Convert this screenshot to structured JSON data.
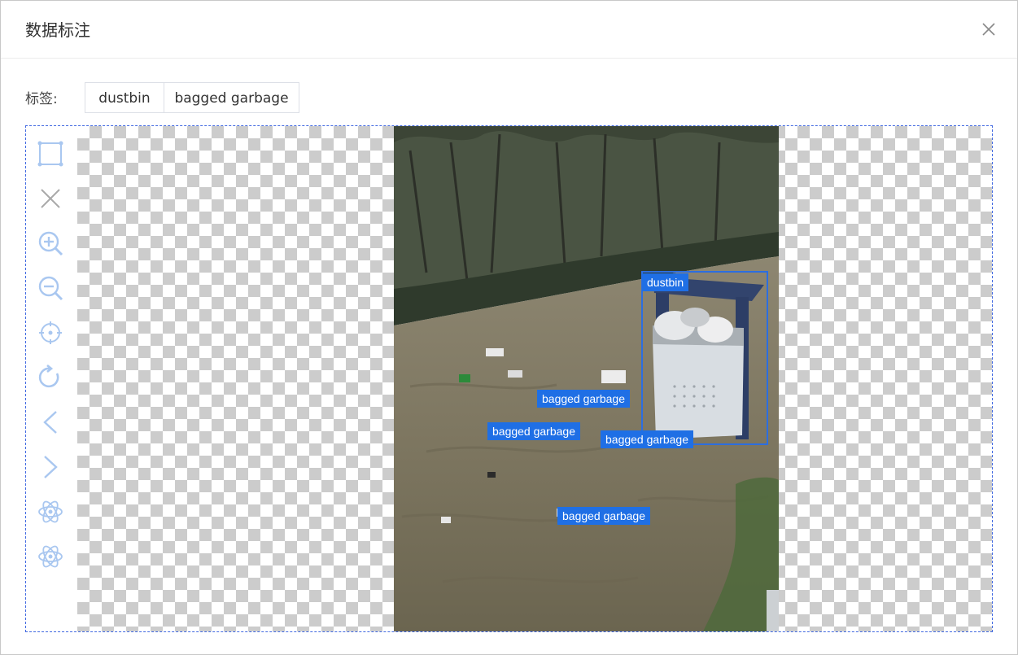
{
  "dialog": {
    "title": "数据标注",
    "close_icon": "close-icon"
  },
  "tags": {
    "label": "标签:",
    "items": [
      {
        "label": "dustbin"
      },
      {
        "label": "bagged garbage"
      }
    ]
  },
  "toolbar": {
    "tools": [
      {
        "icon": "rectangle-tool-icon"
      },
      {
        "icon": "delete-icon"
      },
      {
        "icon": "zoom-in-icon"
      },
      {
        "icon": "zoom-out-icon"
      },
      {
        "icon": "locate-icon"
      },
      {
        "icon": "rotate-icon"
      },
      {
        "icon": "previous-icon"
      },
      {
        "icon": "next-icon"
      },
      {
        "icon": "auto-label-icon"
      },
      {
        "icon": "auto-label-icon"
      }
    ]
  },
  "annotations": [
    {
      "label": "dustbin"
    },
    {
      "label": "bagged garbage"
    },
    {
      "label": "bagged garbage"
    },
    {
      "label": "bagged garbage"
    },
    {
      "label": "bagged garbage"
    }
  ],
  "colors": {
    "accent": "#1f6fe5",
    "icon": "#a9c7f0",
    "border": "#4169e1"
  }
}
